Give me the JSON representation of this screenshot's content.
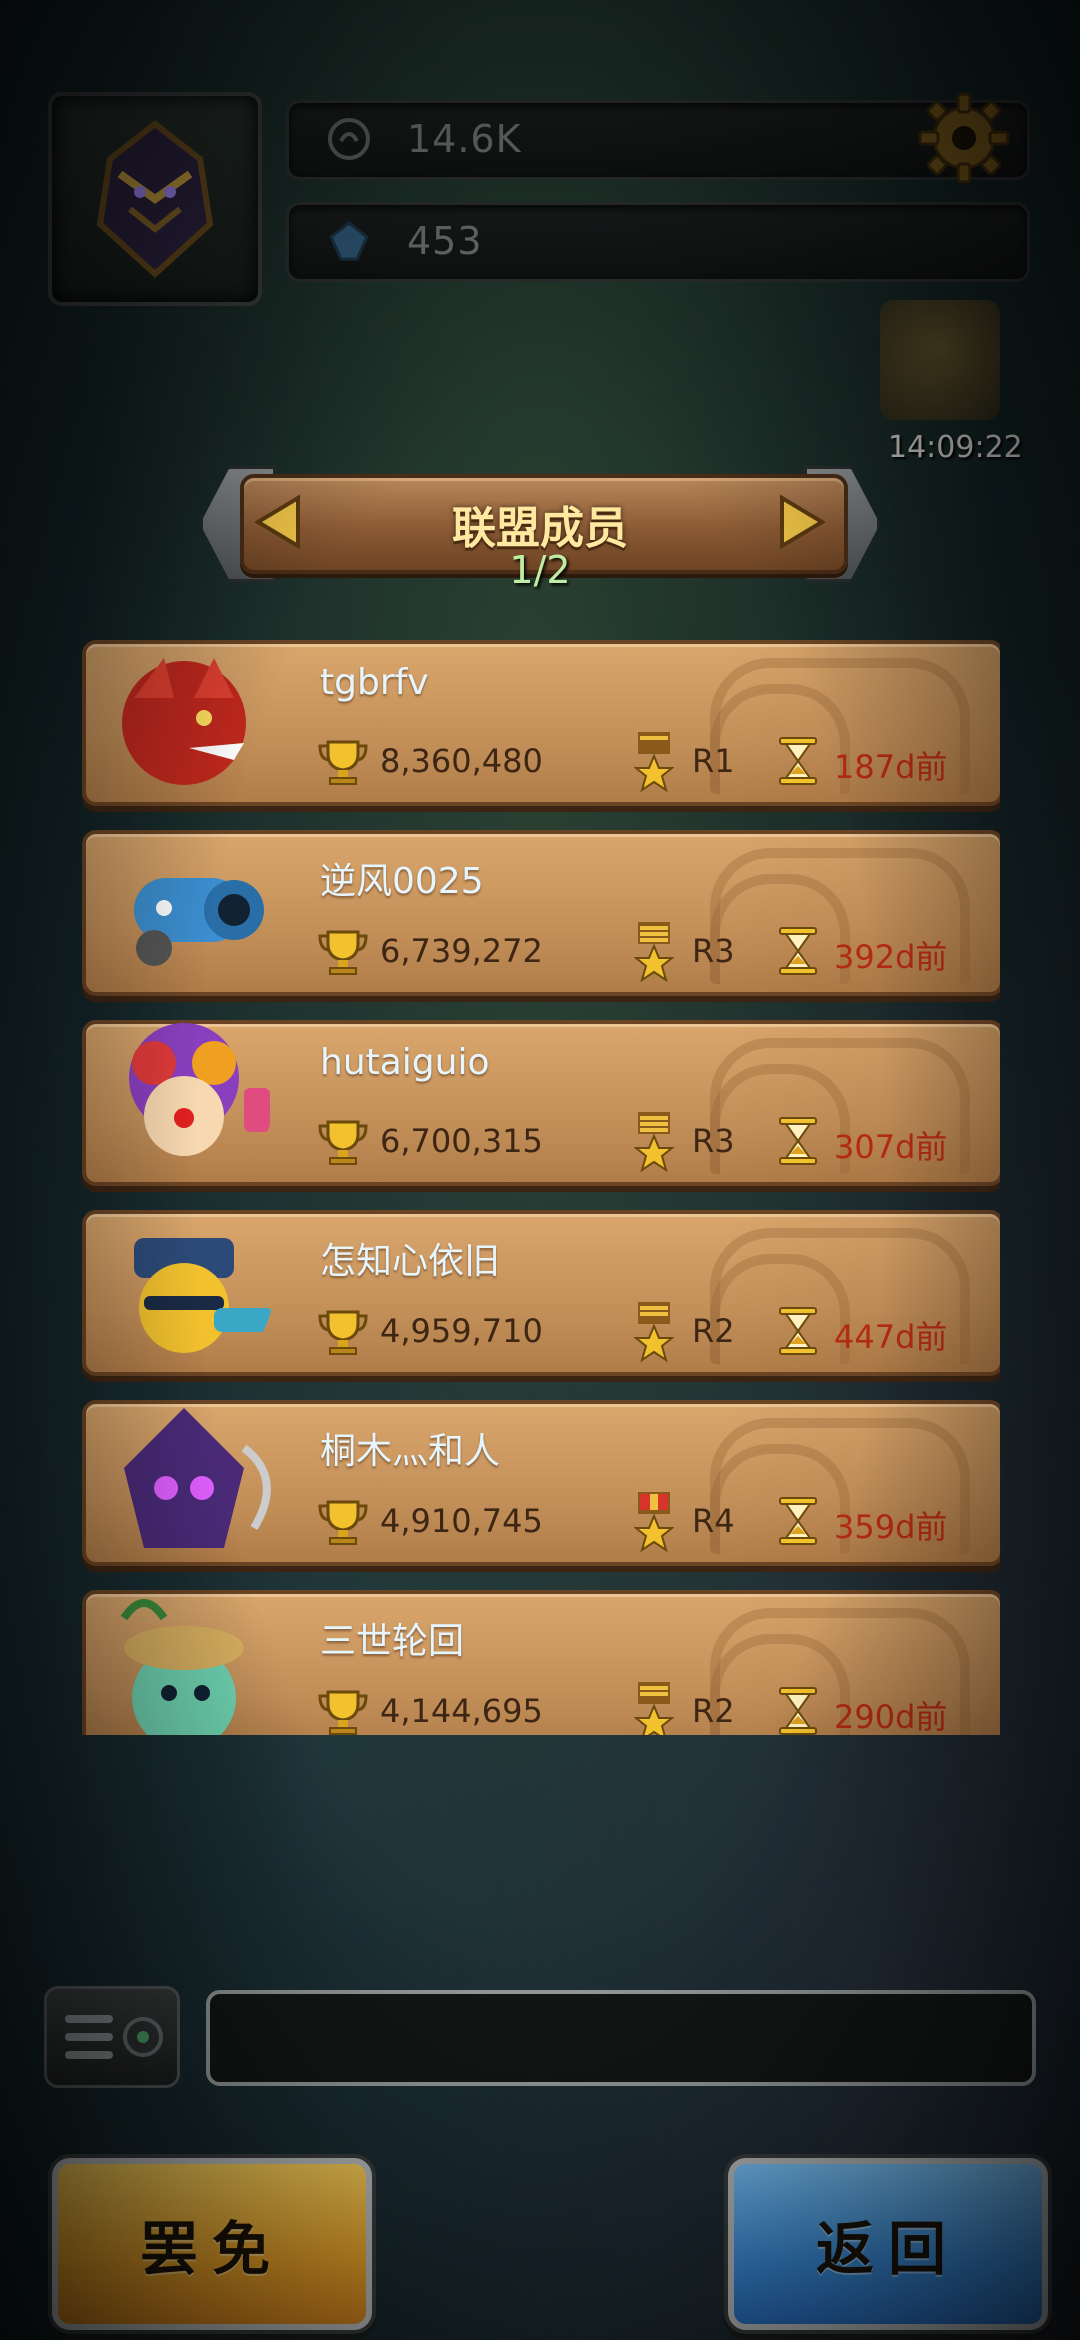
{
  "hud": {
    "coins": "14.6K",
    "gems": "453",
    "timer": "14:09:22"
  },
  "panel": {
    "title": "联盟成员",
    "page": "1/2"
  },
  "members": [
    {
      "name": "tgbrfv",
      "trophies": "8,360,480",
      "rank": "R1",
      "last_seen": "187d前",
      "avatar": "red-dragon"
    },
    {
      "name": "逆风0025",
      "trophies": "6,739,272",
      "rank": "R3",
      "last_seen": "392d前",
      "avatar": "blue-cannon"
    },
    {
      "name": "hutaiguio",
      "trophies": "6,700,315",
      "rank": "R3",
      "last_seen": "307d前",
      "avatar": "clown"
    },
    {
      "name": "怎知心依旧",
      "trophies": "4,959,710",
      "rank": "R2",
      "last_seen": "447d前",
      "avatar": "soldier"
    },
    {
      "name": "桐木灬和人",
      "trophies": "4,910,745",
      "rank": "R4",
      "last_seen": "359d前",
      "avatar": "purple-reaper"
    },
    {
      "name": "三世轮回",
      "trophies": "4,144,695",
      "rank": "R2",
      "last_seen": "290d前",
      "avatar": "plant-creature"
    }
  ],
  "buttons": {
    "kick": "罢免",
    "back": "返回"
  },
  "colors": {
    "kick_button": "#f1a82a",
    "back_button": "#3d94e6",
    "last_seen_text": "#b22a14",
    "card": "#c4905a"
  }
}
